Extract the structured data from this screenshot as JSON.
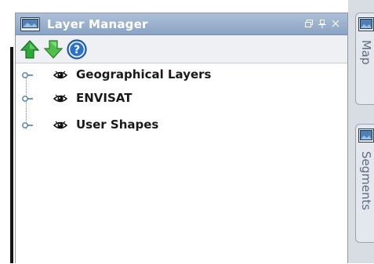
{
  "panel": {
    "title": "Layer Manager",
    "toolbar": {
      "move_up": "arrow-up-icon",
      "move_down": "arrow-down-icon",
      "help": "help-icon"
    }
  },
  "layers": [
    {
      "label": "Geographical Layers",
      "visible": true
    },
    {
      "label": "ENVISAT",
      "visible": true
    },
    {
      "label": "User Shapes",
      "visible": true
    }
  ],
  "side_tabs": [
    {
      "label": "Map"
    },
    {
      "label": "Segments"
    }
  ],
  "colors": {
    "titlebar": "#9db2cf",
    "up_arrow": "#2fa83a",
    "down_arrow": "#4fbf4a",
    "help": "#2d72c8"
  }
}
